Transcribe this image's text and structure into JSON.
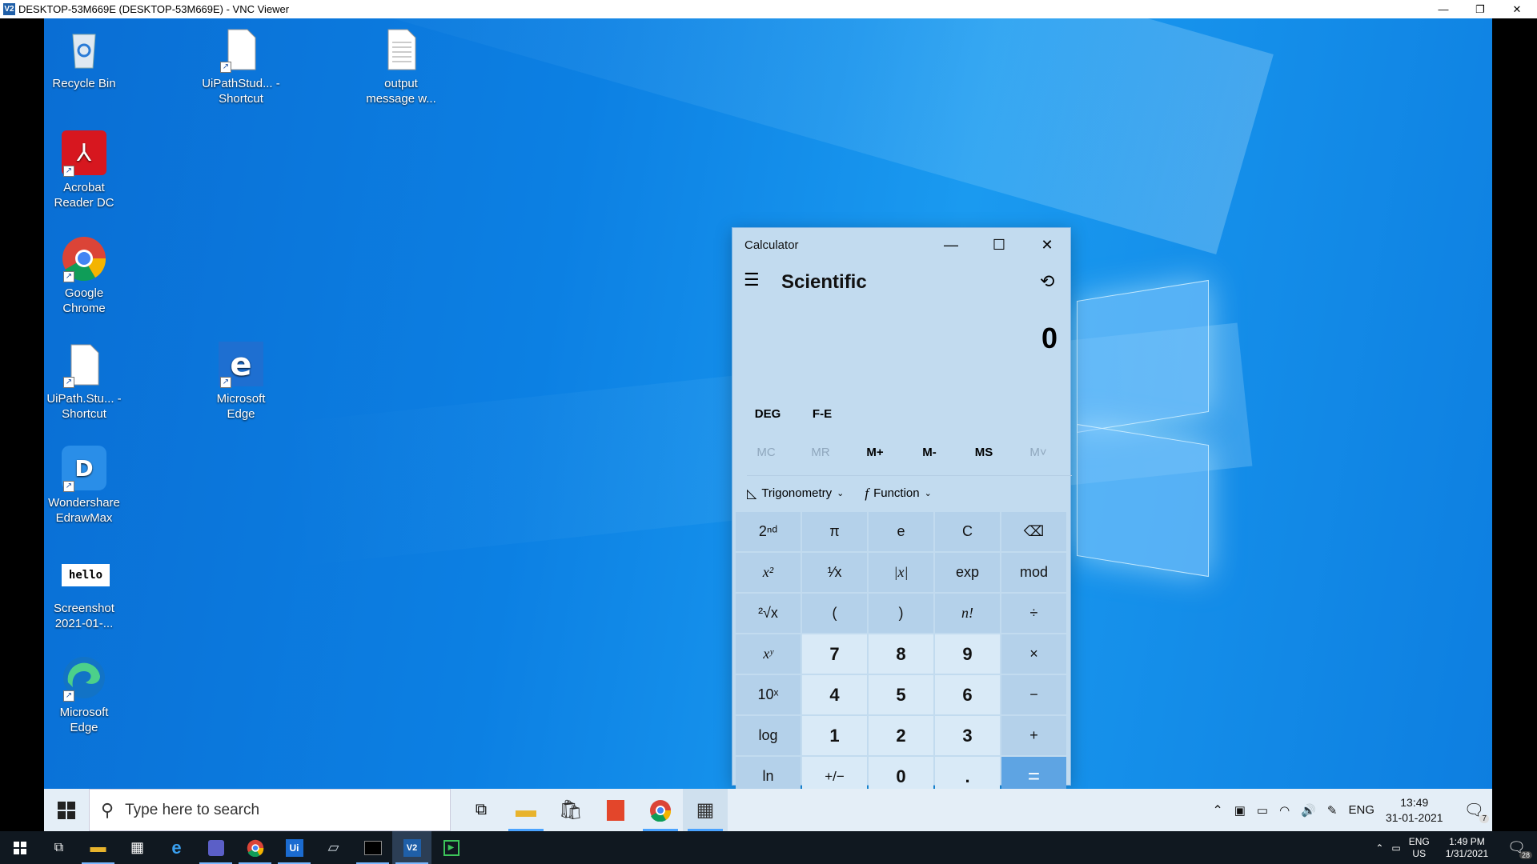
{
  "vnc": {
    "title": "DESKTOP-53M669E (DESKTOP-53M669E) - VNC Viewer",
    "logo": "V2"
  },
  "desktop_icons": [
    {
      "label": "Recycle Bin",
      "icon": "recycle-bin-icon"
    },
    {
      "label": "UiPathStud... - Shortcut",
      "icon": "document-icon"
    },
    {
      "label": "output message w...",
      "icon": "text-file-icon"
    },
    {
      "label": "Acrobat Reader DC",
      "icon": "acrobat-icon"
    },
    {
      "label": "Google Chrome",
      "icon": "chrome-icon"
    },
    {
      "label": "UiPath.Stu... - Shortcut",
      "icon": "document-icon"
    },
    {
      "label": "Microsoft Edge",
      "icon": "edge-legacy-icon"
    },
    {
      "label": "Wondershare EdrawMax",
      "icon": "edrawmax-icon"
    },
    {
      "label": "Screenshot 2021-01-...",
      "icon": "image-icon",
      "thumb": "hello"
    },
    {
      "label": "Microsoft Edge",
      "icon": "edge-icon"
    }
  ],
  "calculator": {
    "title": "Calculator",
    "mode": "Scientific",
    "display": "0",
    "angle": "DEG",
    "fe": "F-E",
    "memory": [
      {
        "label": "MC",
        "enabled": false
      },
      {
        "label": "MR",
        "enabled": false
      },
      {
        "label": "M+",
        "enabled": true
      },
      {
        "label": "M-",
        "enabled": true
      },
      {
        "label": "MS",
        "enabled": true
      },
      {
        "label": "M˅",
        "enabled": false
      }
    ],
    "trig_label": "Trigonometry",
    "func_label": "Function",
    "keys": [
      [
        "2ⁿᵈ",
        "π",
        "e",
        "C",
        "⌫"
      ],
      [
        "x²",
        "¹⁄x",
        "|x|",
        "exp",
        "mod"
      ],
      [
        "²√x",
        "(",
        ")",
        "n!",
        "÷"
      ],
      [
        "xʸ",
        "7",
        "8",
        "9",
        "×"
      ],
      [
        "10ˣ",
        "4",
        "5",
        "6",
        "−"
      ],
      [
        "log",
        "1",
        "2",
        "3",
        "+"
      ],
      [
        "ln",
        "+/−",
        "0",
        ".",
        "="
      ]
    ]
  },
  "taskbar": {
    "search_placeholder": "Type here to search",
    "lang": "ENG",
    "time": "13:49",
    "date": "31-01-2021",
    "notif_count": "7"
  },
  "host_taskbar": {
    "lang": "ENG",
    "region": "US",
    "time": "1:49 PM",
    "date": "1/31/2021",
    "notif_count": "28"
  },
  "colors": {
    "accent": "#0078d7",
    "equals": "#5ea4e3"
  }
}
